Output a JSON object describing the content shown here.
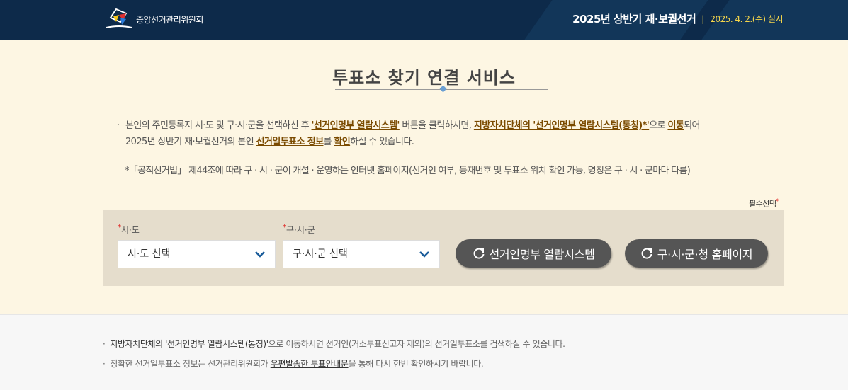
{
  "header": {
    "org_name": "중앙선거관리위원회",
    "election_title": "2025년 상반기 재·보궐선거",
    "separator": "|",
    "election_date": "2025. 4. 2.(수) 실시"
  },
  "main": {
    "title": "투표소 찾기 연결 서비스",
    "desc_bullet": "·",
    "desc": {
      "p1": "본인의 주민등록지 시·도 및 구·시·군을 선택하신 후 ",
      "e1": "'선거인명부 열람시스템'",
      "p2": " 버튼을 클릭하시면, ",
      "e2": "지방자치단체의 '선거인명부 열람시스템(통칭)*'",
      "p3": "으로 ",
      "e3": "이동",
      "p4": "되어",
      "p5": "2025년 상반기 재·보궐선거의 본인 ",
      "e4": "선거일투표소 정보",
      "p6": "를 ",
      "e5": "확인",
      "p7": "하실 수 있습니다."
    },
    "note": "*「공직선거법」 제44조에 따라 구 · 시 · 군이 개설 · 운영하는 인터넷 홈페이지(선거인 여부, 등재번호 및 투표소 위치 확인 가능, 명칭은 구 · 시 · 군마다 다름)"
  },
  "required_label": "필수선택",
  "required_mark": "*",
  "form": {
    "sido_label": "시·도",
    "sido_value": "시·도 선택",
    "gusigun_label": "구·시·군",
    "gusigun_value": "구·시·군 선택",
    "btn_registry": "선거인명부 열람시스템",
    "btn_homepage": "구·시·군·청 홈페이지"
  },
  "footer": {
    "bullet": "·",
    "n1_link": "지방자치단체의 '선거인명부 열람시스템(통칭)'",
    "n1_text": "으로 이동하시면 선거인(거소투표신고자 제외)의 선거일투표소를 검색하실 수 있습니다.",
    "n2_a": "정확한 선거일투표소 정보는 선거관리위원회가 ",
    "n2_link": "우편발송한 투표안내문",
    "n2_b": "을 통해 다시 한번 확인하시기 바랍니다."
  },
  "colors": {
    "header_bg": "#0d2a4a",
    "accent_yellow": "#f5d54a",
    "page_bg": "#fdf6e3",
    "panel_bg": "#e5ddcc",
    "button_bg": "#555555",
    "emphasis": "#7a4a00"
  },
  "icons": [
    "nec-logo",
    "chevron-down-icon",
    "refresh-icon"
  ]
}
